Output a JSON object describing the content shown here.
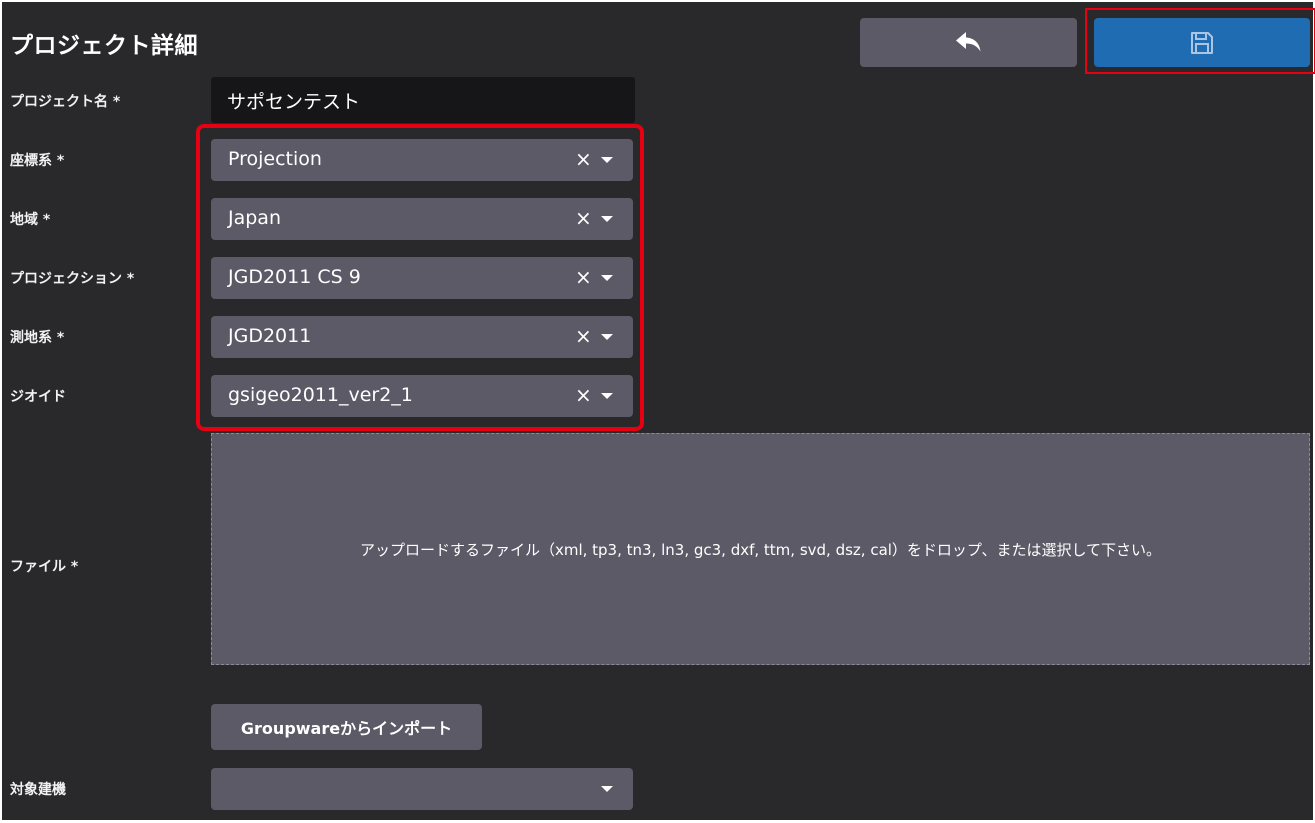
{
  "header": {
    "title": "プロジェクト詳細",
    "back_icon": "reply-arrow-icon",
    "save_icon": "floppy-disk-icon"
  },
  "fields": {
    "project_name": {
      "label": "プロジェクト名 *",
      "value": "サポセンテスト"
    },
    "coordinate_system": {
      "label": "座標系 *",
      "value": "Projection"
    },
    "region": {
      "label": "地域 *",
      "value": "Japan"
    },
    "projection": {
      "label": "プロジェクション *",
      "value": "JGD2011 CS 9"
    },
    "datum": {
      "label": "測地系 *",
      "value": "JGD2011"
    },
    "geoid": {
      "label": "ジオイド",
      "value": "gsigeo2011_ver2_1"
    },
    "file": {
      "label": "ファイル *",
      "dropzone_text": "アップロードするファイル（xml, tp3, tn3, ln3, gc3, dxf, ttm, svd, dsz, cal）をドロップ、または選択して下さい。"
    },
    "import_button": "Groupwareからインポート",
    "target_machine": {
      "label": "対象建機",
      "value": ""
    }
  },
  "icons": {
    "clear": "×"
  },
  "colors": {
    "background": "#29292c",
    "control": "#5b5a66",
    "input": "#161618",
    "save": "#1f6cb3",
    "highlight": "#e60012"
  }
}
